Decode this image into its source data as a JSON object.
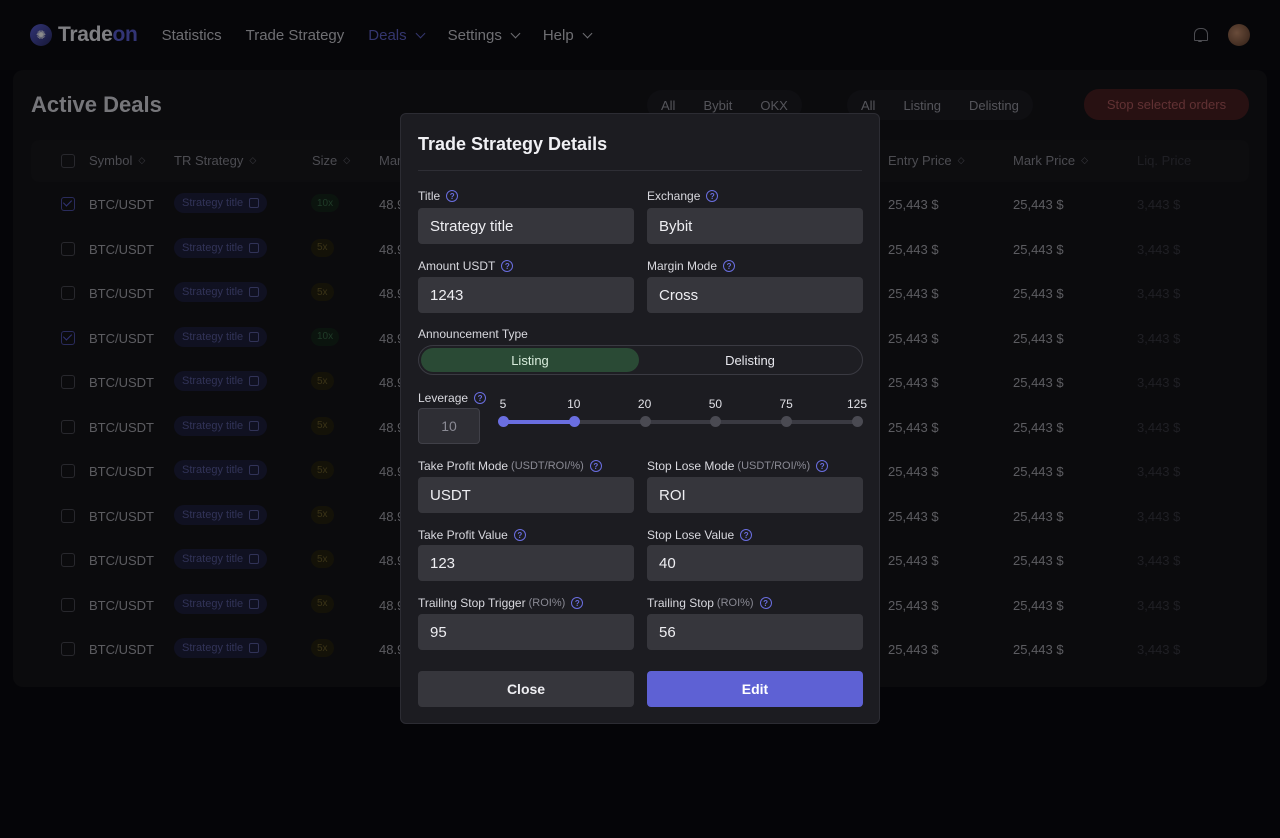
{
  "brand": {
    "logo_symbol": "✺",
    "name_part1": "Trade",
    "name_part2": "on"
  },
  "nav": [
    {
      "label": "Statistics",
      "has_dropdown": false,
      "active": false
    },
    {
      "label": "Trade Strategy",
      "has_dropdown": false,
      "active": false
    },
    {
      "label": "Deals",
      "has_dropdown": true,
      "active": true
    },
    {
      "label": "Settings",
      "has_dropdown": true,
      "active": false
    },
    {
      "label": "Help",
      "has_dropdown": true,
      "active": false
    }
  ],
  "page": {
    "title": "Active Deals",
    "exchange_filters": [
      "All",
      "Bybit",
      "OKX"
    ],
    "type_filters": [
      "All",
      "Listing",
      "Delisting"
    ],
    "stop_button": "Stop selected orders"
  },
  "table": {
    "headers": {
      "symbol": "Symbol",
      "strategy": "TR Strategy",
      "size": "Size",
      "margin": "Mar",
      "entry_price": "Entry Price",
      "mark_price": "Mark Price",
      "liq_price": "Liq. Price"
    },
    "sort_glyph": "◇",
    "rows": [
      {
        "symbol": "BTC/USDT",
        "strategy": "Strategy title",
        "leverage": "10x",
        "margin": "48.9",
        "entry": "25,443 $",
        "mark": "25,443 $",
        "liq": "3,443 $",
        "checked": true,
        "lev_color": "green"
      },
      {
        "symbol": "BTC/USDT",
        "strategy": "Strategy title",
        "leverage": "5x",
        "margin": "48.9",
        "entry": "25,443 $",
        "mark": "25,443 $",
        "liq": "3,443 $",
        "checked": false,
        "lev_color": "yellow"
      },
      {
        "symbol": "BTC/USDT",
        "strategy": "Strategy title",
        "leverage": "5x",
        "margin": "48.9",
        "entry": "25,443 $",
        "mark": "25,443 $",
        "liq": "3,443 $",
        "checked": false,
        "lev_color": "yellow"
      },
      {
        "symbol": "BTC/USDT",
        "strategy": "Strategy title",
        "leverage": "10x",
        "margin": "48.9",
        "entry": "25,443 $",
        "mark": "25,443 $",
        "liq": "3,443 $",
        "checked": true,
        "lev_color": "green"
      },
      {
        "symbol": "BTC/USDT",
        "strategy": "Strategy title",
        "leverage": "5x",
        "margin": "48.9",
        "entry": "25,443 $",
        "mark": "25,443 $",
        "liq": "3,443 $",
        "checked": false,
        "lev_color": "yellow"
      },
      {
        "symbol": "BTC/USDT",
        "strategy": "Strategy title",
        "leverage": "5x",
        "margin": "48.9",
        "entry": "25,443 $",
        "mark": "25,443 $",
        "liq": "3,443 $",
        "checked": false,
        "lev_color": "yellow"
      },
      {
        "symbol": "BTC/USDT",
        "strategy": "Strategy title",
        "leverage": "5x",
        "margin": "48.9",
        "entry": "25,443 $",
        "mark": "25,443 $",
        "liq": "3,443 $",
        "checked": false,
        "lev_color": "yellow"
      },
      {
        "symbol": "BTC/USDT",
        "strategy": "Strategy title",
        "leverage": "5x",
        "margin": "48.9",
        "entry": "25,443 $",
        "mark": "25,443 $",
        "liq": "3,443 $",
        "checked": false,
        "lev_color": "yellow"
      },
      {
        "symbol": "BTC/USDT",
        "strategy": "Strategy title",
        "leverage": "5x",
        "margin": "48.9",
        "entry": "25,443 $",
        "mark": "25,443 $",
        "liq": "3,443 $",
        "checked": false,
        "lev_color": "yellow"
      },
      {
        "symbol": "BTC/USDT",
        "strategy": "Strategy title",
        "leverage": "5x",
        "margin": "48.9",
        "entry": "25,443 $",
        "mark": "25,443 $",
        "liq": "3,443 $",
        "checked": false,
        "lev_color": "yellow"
      },
      {
        "symbol": "BTC/USDT",
        "strategy": "Strategy title",
        "leverage": "5x",
        "margin": "48.9",
        "entry": "25,443 $",
        "mark": "25,443 $",
        "liq": "3,443 $",
        "checked": false,
        "lev_color": "yellow"
      }
    ]
  },
  "modal": {
    "title": "Trade Strategy Details",
    "help_glyph": "?",
    "title_label": "Title",
    "title_value": "Strategy title",
    "exchange_label": "Exchange",
    "exchange_value": "Bybit",
    "amount_label": "Amount USDT",
    "amount_value": "1243",
    "margin_mode_label": "Margin Mode",
    "margin_mode_value": "Cross",
    "announcement_label": "Announcement Type",
    "announcement_options": [
      "Listing",
      "Delisting"
    ],
    "announcement_selected": "Listing",
    "leverage_label": "Leverage",
    "leverage_value": "10",
    "leverage_ticks": [
      "5",
      "10",
      "20",
      "50",
      "75",
      "125"
    ],
    "tp_mode_label": "Take Profit Mode",
    "tp_mode_sub": "(USDT/ROI/%)",
    "tp_mode_value": "USDT",
    "sl_mode_label": "Stop Lose Mode",
    "sl_mode_sub": "(USDT/ROI/%)",
    "sl_mode_value": "ROI",
    "tp_value_label": "Take Profit Value",
    "tp_value": "123",
    "sl_value_label": "Stop Lose Value",
    "sl_value": "40",
    "trailing_trigger_label": "Trailing Stop Trigger",
    "trailing_trigger_sub": "(ROI%)",
    "trailing_trigger_value": "95",
    "trailing_stop_label": "Trailing Stop",
    "trailing_stop_sub": "(ROI%)",
    "trailing_stop_value": "56",
    "close_label": "Close",
    "edit_label": "Edit"
  },
  "colors": {
    "accent": "#5e61d4",
    "listing_active": "#2a4a35",
    "stop_button": "#4a1f22",
    "background": "#0a0a0f"
  }
}
